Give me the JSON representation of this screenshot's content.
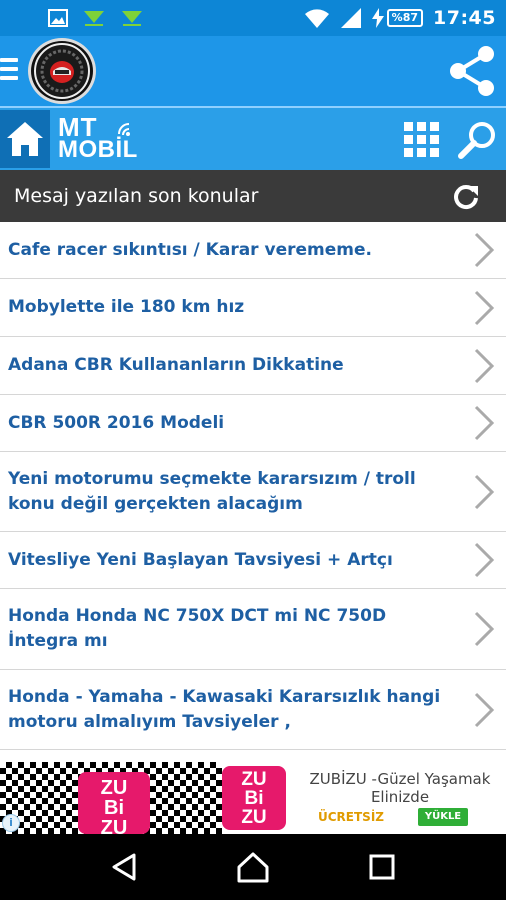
{
  "status_bar": {
    "time": "17:45",
    "battery": "%87",
    "icons": [
      "image-icon",
      "download-icon",
      "download-icon",
      "wifi-icon",
      "signal-icon",
      "charging-icon"
    ]
  },
  "app_bar": {
    "menu_icon": "hamburger-icon",
    "share_icon": "share-icon"
  },
  "nav_bar": {
    "brand_top": "MT",
    "brand_bottom": "MOBİL",
    "home_icon": "home-icon",
    "grid_icon": "grid-icon",
    "search_icon": "search-icon"
  },
  "section": {
    "title": "Mesaj yazılan son konular",
    "refresh_icon": "refresh-icon"
  },
  "topics": [
    "Cafe racer sıkıntısı / Karar verememe.",
    "Mobylette ile 180 km hız",
    "Adana CBR Kullananların Dikkatine",
    "CBR 500R 2016 Modeli",
    "Yeni motorumu seçmekte kararsızım / troll konu değil gerçekten alacağım",
    "Vitesliye Yeni Başlayan Tavsiyesi + Artçı",
    "Honda Honda NC 750X DCT mi NC 750D İntegra mı",
    "Honda - Yamaha - Kawasaki Kararsızlık hangi motoru almalıyım Tavsiyeler ,"
  ],
  "ad": {
    "brand_1": "ZU\nBi\nZU",
    "brand_2": "ZU\nBi\nZU",
    "text": "ZUBİZU -Güzel Yaşamak Elinizde",
    "free_label": "ÜCRETSİZ",
    "install_label": "YÜKLE",
    "info_icon": "info-icon"
  },
  "colors": {
    "status_bar": "#0d86d6",
    "app_bar": "#1e96e8",
    "nav_bar": "#2b9fe8",
    "section_header": "#3a3a3a",
    "topic_text": "#1e5fa3",
    "ad_pink": "#e6196b",
    "ad_green": "#2fae37"
  }
}
